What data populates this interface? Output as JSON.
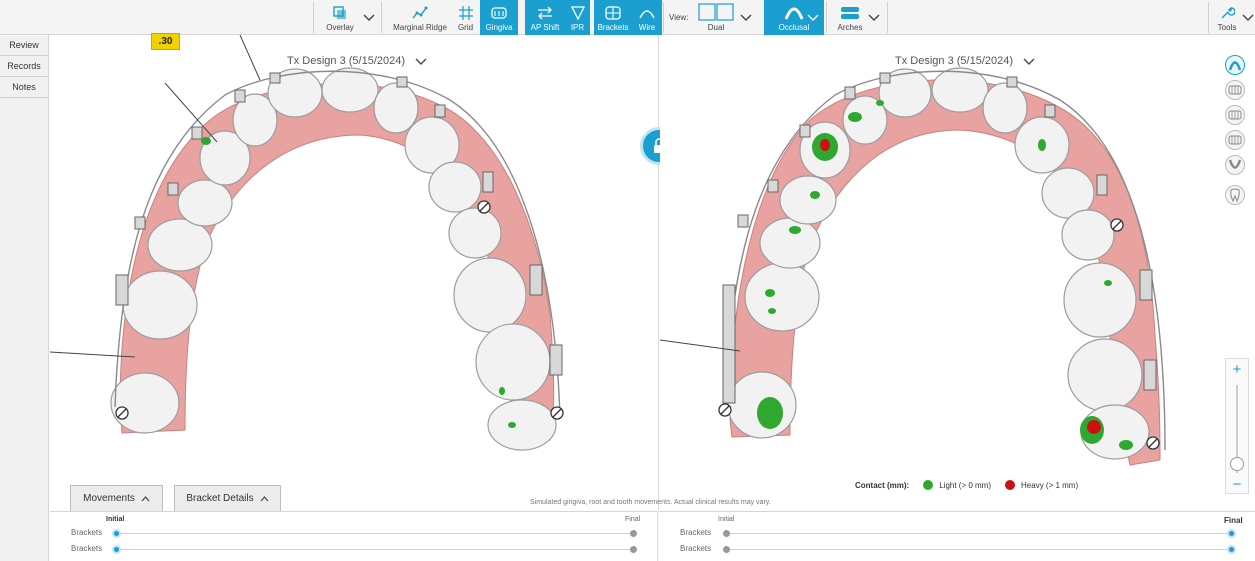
{
  "toolbar": {
    "overlay": "Overlay",
    "marginal_ridge": "Marginal Ridge",
    "grid": "Grid",
    "gingiva": "Gingiva",
    "ap_shift": "AP Shift",
    "ipr": "IPR",
    "brackets": "Brackets",
    "wire": "Wire",
    "view_label": "View:",
    "dual": "Dual",
    "occlusal": "Occlusal",
    "arches": "Arches",
    "tools": "Tools"
  },
  "sidebar": {
    "items": [
      {
        "label": "Review"
      },
      {
        "label": "Records"
      },
      {
        "label": "Notes"
      }
    ]
  },
  "left_view": {
    "title": "Tx Design 3 (5/15/2024)",
    "tag": ".30"
  },
  "right_view": {
    "title": "Tx Design 3 (5/15/2024)"
  },
  "legend": {
    "label": "Contact (mm):",
    "light": "Light (> 0 mm)",
    "heavy": "Heavy (> 1 mm)",
    "light_color": "#2fa82f",
    "heavy_color": "#cc1111"
  },
  "disclaimer": "Simulated gingiva, root and tooth movements. Actual clinical results may vary.",
  "tabs": {
    "movements": "Movements",
    "bracket_details": "Bracket Details"
  },
  "timeline_left": {
    "initial": "Initial",
    "final": "Final",
    "rows": [
      "Brackets",
      "Brackets"
    ],
    "position": 0
  },
  "timeline_right": {
    "initial": "Initial",
    "final": "Final",
    "rows": [
      "Brackets",
      "Brackets"
    ],
    "position": 1
  },
  "colors": {
    "accent": "#1a9fd0",
    "gingiva": "#e8a3a0",
    "tooth": "#f2f2f2"
  }
}
